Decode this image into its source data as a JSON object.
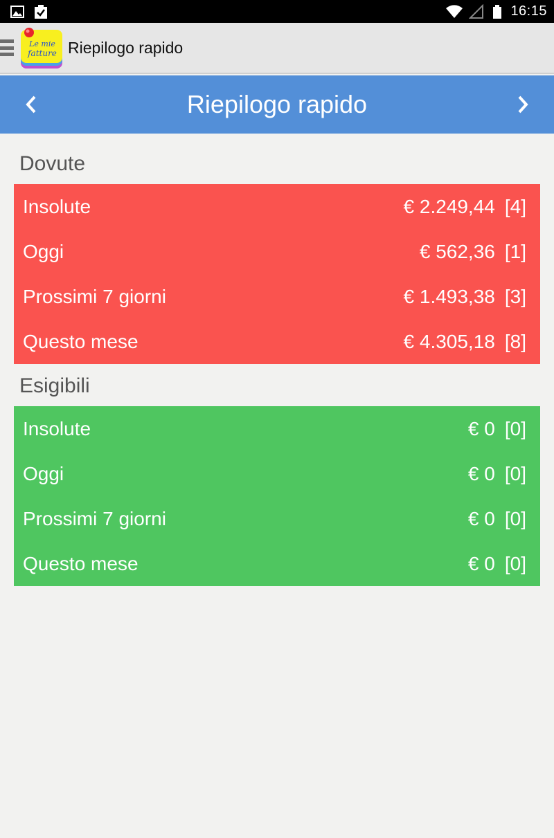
{
  "status_bar": {
    "time": "16:15",
    "icons_left": [
      "gallery-icon",
      "clipboard-check-icon"
    ],
    "icons_right": [
      "wifi-icon",
      "signal-icon",
      "battery-icon"
    ]
  },
  "action_bar": {
    "title": "Riepilogo rapido",
    "logo_text_line1": "Le mie",
    "logo_text_line2": "fatture"
  },
  "nav_header": {
    "title": "Riepilogo rapido",
    "prev_symbol": "‹",
    "next_symbol": "›"
  },
  "sections": {
    "dovute": {
      "title": "Dovute",
      "color": "#fa534f",
      "rows": [
        {
          "label": "Insolute",
          "amount": "€ 2.249,44",
          "count": "[4]"
        },
        {
          "label": "Oggi",
          "amount": "€ 562,36",
          "count": "[1]"
        },
        {
          "label": "Prossimi 7 giorni",
          "amount": "€ 1.493,38",
          "count": "[3]"
        },
        {
          "label": "Questo mese",
          "amount": "€ 4.305,18",
          "count": "[8]"
        }
      ]
    },
    "esigibili": {
      "title": "Esigibili",
      "color": "#4fc660",
      "rows": [
        {
          "label": "Insolute",
          "amount": "€ 0",
          "count": "[0]"
        },
        {
          "label": "Oggi",
          "amount": "€ 0",
          "count": "[0]"
        },
        {
          "label": "Prossimi 7 giorni",
          "amount": "€ 0",
          "count": "[0]"
        },
        {
          "label": "Questo mese",
          "amount": "€ 0",
          "count": "[0]"
        }
      ]
    }
  },
  "colors": {
    "header_blue": "#538fd8",
    "background": "#f2f2f0"
  }
}
